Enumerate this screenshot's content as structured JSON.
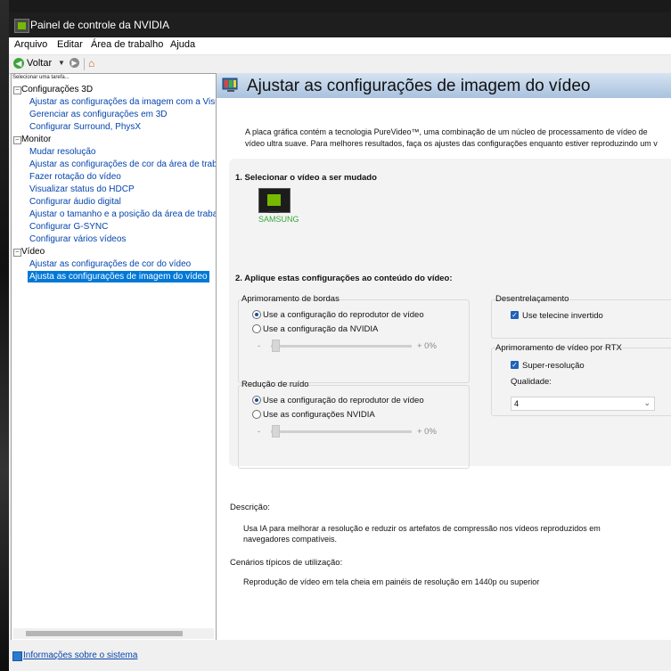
{
  "window": {
    "title": "Painel de controle da NVIDIA"
  },
  "menu": {
    "items": [
      "Arquivo",
      "Editar",
      "Área de trabalho",
      "Ajuda"
    ]
  },
  "toolbar": {
    "back_label": "Voltar",
    "icons": [
      "back-arrow-icon",
      "dropdown-icon",
      "forward-arrow-icon",
      "home-icon"
    ]
  },
  "sidebar": {
    "header": "Selecionar uma tarefa...",
    "categories": [
      {
        "label": "Configurações 3D",
        "items": [
          "Ajustar as configurações da imagem com a Visual",
          "Gerenciar as configurações em 3D",
          "Configurar Surround, PhysX"
        ]
      },
      {
        "label": "Monitor",
        "items": [
          "Mudar resolução",
          "Ajustar as configurações de cor da área de trabal",
          "Fazer rotação do vídeo",
          "Visualizar status do HDCP",
          "Configurar áudio digital",
          "Ajustar o tamanho e a posição da área de trabalh",
          "Configurar G-SYNC",
          "Configurar vários vídeos"
        ]
      },
      {
        "label": "Vídeo",
        "items": [
          "Ajustar as configurações de cor do vídeo",
          "Ajusta as configurações de imagem do vídeo"
        ]
      }
    ],
    "selected": "Ajusta as configurações de imagem do vídeo",
    "system_info_link": "Informações sobre o sistema"
  },
  "main": {
    "title": "Ajustar as configurações de imagem do vídeo",
    "intro_line1": "A placa gráfica contém a tecnologia PureVideo™, uma combinação de um núcleo de processamento de vídeo de",
    "intro_line2": "vídeo ultra suave. Para melhores resultados, faça os ajustes das configurações enquanto estiver reproduzindo um v",
    "section1_title": "1. Selecionar o vídeo a ser mudado",
    "display_label": "SAMSUNG",
    "section2_title": "2. Aplique estas configurações ao conteúdo do vídeo:",
    "edge": {
      "title": "Aprimoramento de bordas",
      "opt1": "Use a configuração do reprodutor de vídeo",
      "opt2": "Use a configuração da NVIDIA",
      "selected": 1,
      "slider_minus": "-",
      "slider_value": "+ 0%"
    },
    "noise": {
      "title": "Redução de ruído",
      "opt1": "Use a configuração do reprodutor de vídeo",
      "opt2": "Use as configurações NVIDIA",
      "selected": 1,
      "slider_minus": "-",
      "slider_value": "+ 0%"
    },
    "deinterlace": {
      "title": "Desentrelaçamento",
      "check_label": "Use telecine invertido",
      "checked": true
    },
    "rtx": {
      "title": "Aprimoramento de vídeo por RTX",
      "check_label": "Super-resolução",
      "checked": true,
      "quality_label": "Qualidade:",
      "quality_value": "4"
    },
    "description": {
      "heading": "Descrição:",
      "line1": "Usa IA para melhorar a resolução e reduzir os artefatos de compressão nos vídeos reproduzidos em",
      "line2": "navegadores compatíveis."
    },
    "scenarios": {
      "heading": "Cenários típicos de utilização:",
      "text": "Reprodução de vídeo em tela cheia em painéis de resolução em 1440p ou superior"
    }
  }
}
